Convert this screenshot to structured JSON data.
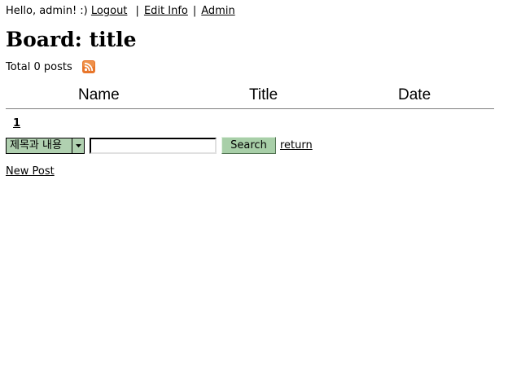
{
  "user_bar": {
    "greeting": "Hello, admin! :)",
    "logout": "Logout",
    "edit_info": "Edit Info",
    "admin": "Admin",
    "separator": "|"
  },
  "board": {
    "title": "Board: title",
    "post_count": "Total 0 posts",
    "rss_icon": "rss-feed-icon",
    "rss_color": "#e8762b"
  },
  "table": {
    "columns": [
      "Name",
      "Title",
      "Date"
    ]
  },
  "pager": {
    "current_page": "1"
  },
  "search": {
    "scope_selected": "제목과 내용",
    "query_value": "",
    "button_label": "Search",
    "return_label": "return",
    "button_color": "#a8cfa8",
    "select_color": "#b0d0b0"
  },
  "actions": {
    "new_post": "New Post"
  }
}
